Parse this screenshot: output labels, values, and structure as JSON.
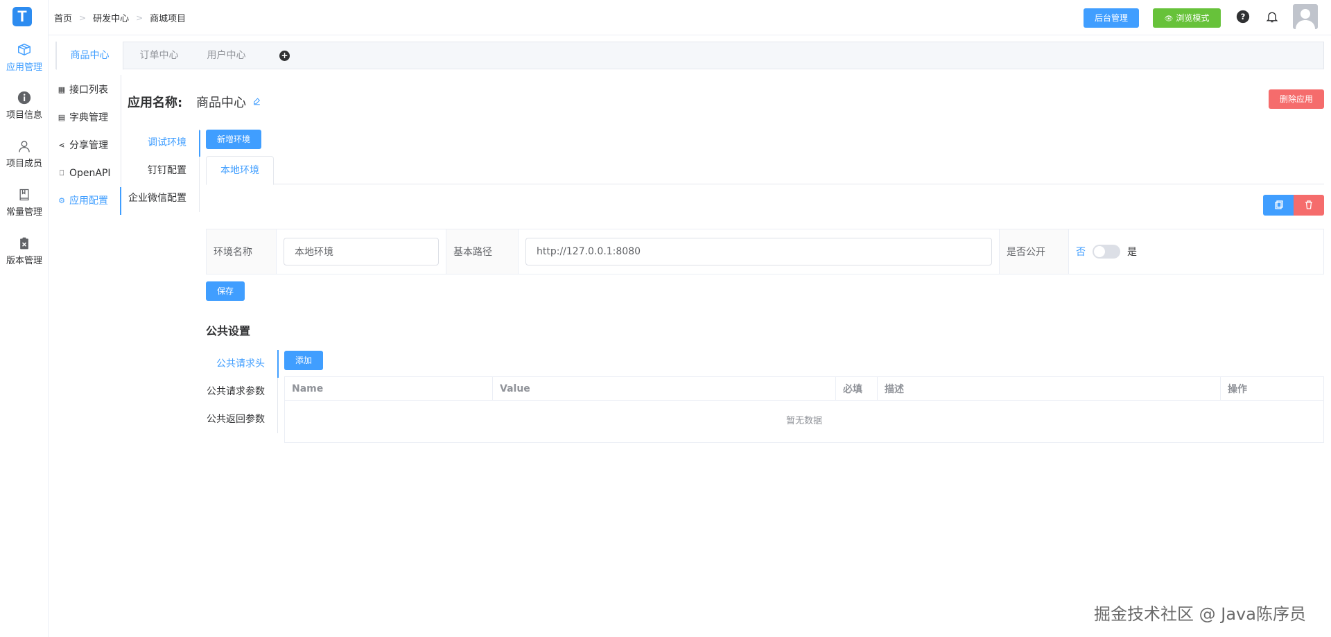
{
  "colors": {
    "primary": "#409eff",
    "success": "#67c23a",
    "danger": "#f56c6c",
    "logo": "#2d8cf0"
  },
  "logo": {
    "letter": "T"
  },
  "rail": [
    {
      "label": "应用管理",
      "icon": "box-icon",
      "active": true
    },
    {
      "label": "项目信息",
      "icon": "info-icon"
    },
    {
      "label": "项目成员",
      "icon": "user-icon"
    },
    {
      "label": "常量管理",
      "icon": "book-icon"
    },
    {
      "label": "版本管理",
      "icon": "clipboard-icon"
    }
  ],
  "breadcrumb": [
    "首页",
    "研发中心",
    "商城项目"
  ],
  "header": {
    "admin_label": "后台管理",
    "browse_label": "浏览模式"
  },
  "app_tabs": [
    "商品中心",
    "订单中心",
    "用户中心"
  ],
  "subnav": [
    {
      "label": "接口列表",
      "icon": "grid-icon"
    },
    {
      "label": "字典管理",
      "icon": "doc-icon"
    },
    {
      "label": "分享管理",
      "icon": "share-icon"
    },
    {
      "label": "OpenAPI",
      "icon": "bookmark-icon"
    },
    {
      "label": "应用配置",
      "icon": "gear-icon",
      "active": true
    }
  ],
  "app": {
    "title_label": "应用名称:",
    "name": "商品中心",
    "delete_label": "删除应用"
  },
  "env_nav": [
    "调试环境",
    "钉钉配置",
    "企业微信配置"
  ],
  "env": {
    "add_label": "新增环境",
    "tab_label": "本地环境",
    "name_label": "环境名称",
    "name_value": "本地环境",
    "path_label": "基本路径",
    "path_value": "http://127.0.0.1:8080",
    "public_label": "是否公开",
    "switch_no": "否",
    "switch_yes": "是",
    "save_label": "保存"
  },
  "public": {
    "title": "公共设置",
    "nav": [
      "公共请求头",
      "公共请求参数",
      "公共返回参数"
    ],
    "add_label": "添加",
    "columns": [
      "Name",
      "Value",
      "必填",
      "描述",
      "操作"
    ],
    "empty_text": "暂无数据"
  },
  "watermark": "掘金技术社区 @ Java陈序员"
}
